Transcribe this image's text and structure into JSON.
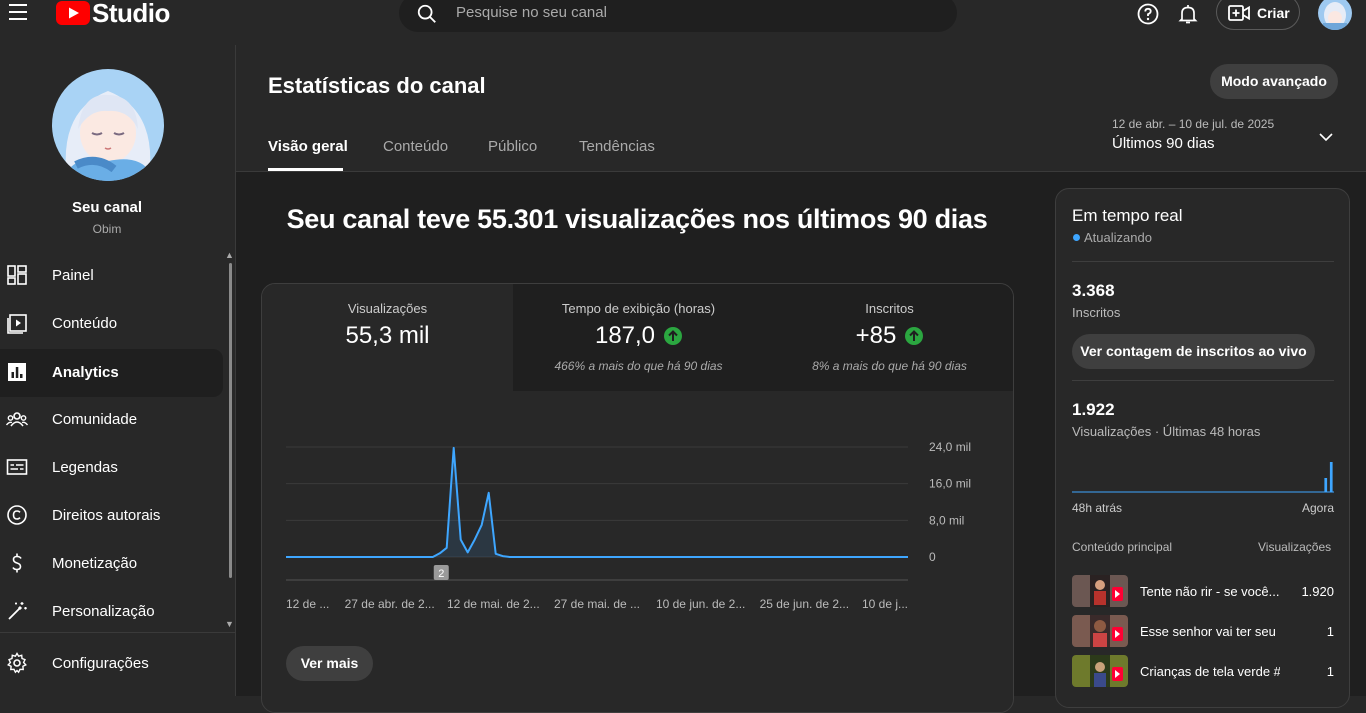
{
  "topbar": {
    "logo_text": "Studio",
    "search_placeholder": "Pesquise no seu canal",
    "create_label": "Criar"
  },
  "sidebar": {
    "channel_title": "Seu canal",
    "channel_name": "Obim",
    "items": [
      {
        "label": "Painel",
        "icon": "dashboard-icon"
      },
      {
        "label": "Conteúdo",
        "icon": "content-icon"
      },
      {
        "label": "Analytics",
        "icon": "analytics-icon",
        "active": true
      },
      {
        "label": "Comunidade",
        "icon": "community-icon"
      },
      {
        "label": "Legendas",
        "icon": "subtitles-icon"
      },
      {
        "label": "Direitos autorais",
        "icon": "copyright-icon"
      },
      {
        "label": "Monetização",
        "icon": "monetization-icon"
      },
      {
        "label": "Personalização",
        "icon": "customization-icon"
      }
    ],
    "settings_label": "Configurações"
  },
  "header": {
    "title": "Estatísticas do canal",
    "advanced_mode": "Modo avançado",
    "tabs": [
      {
        "label": "Visão geral",
        "active": true
      },
      {
        "label": "Conteúdo"
      },
      {
        "label": "Público"
      },
      {
        "label": "Tendências"
      }
    ],
    "date_range": "12 de abr. – 10 de jul. de 2025",
    "date_label": "Últimos 90 dias"
  },
  "main": {
    "headline": "Seu canal teve 55.301 visualizações nos últimos 90 dias",
    "kpis": [
      {
        "label": "Visualizações",
        "value": "55,3 mil",
        "delta": "",
        "selected": true
      },
      {
        "label": "Tempo de exibição (horas)",
        "value": "187,0",
        "delta": "466% a mais do que há 90 dias",
        "up": true
      },
      {
        "label": "Inscritos",
        "value": "+85",
        "delta": "8% a mais do que há 90 dias",
        "up": true
      }
    ],
    "see_more": "Ver mais"
  },
  "chart_data": {
    "type": "area",
    "metric": "Visualizações",
    "y_ticks": [
      "24,0 mil",
      "16,0 mil",
      "8,0 mil",
      "0"
    ],
    "ylim": [
      0,
      24000
    ],
    "x_tick_labels": [
      "12 de ...",
      "27 de abr. de 2...",
      "12 de mai. de 2...",
      "27 de mai. de ...",
      "10 de jun. de 2...",
      "25 de jun. de 2...",
      "10 de j..."
    ],
    "marker_label": "2",
    "marker_day": 22,
    "series": [
      {
        "values": [
          0,
          0,
          0,
          0,
          0,
          0,
          0,
          0,
          0,
          0,
          0,
          0,
          0,
          0,
          0,
          0,
          0,
          0,
          0,
          0,
          0,
          0,
          800,
          2000,
          23800,
          3800,
          1000,
          3800,
          7000,
          14000,
          700,
          200,
          0,
          0,
          0,
          0,
          0,
          0,
          0,
          0,
          0,
          0,
          0,
          0,
          0,
          0,
          0,
          0,
          0,
          0,
          0,
          0,
          0,
          0,
          0,
          0,
          0,
          0,
          0,
          0,
          0,
          0,
          0,
          0,
          0,
          0,
          0,
          0,
          0,
          0,
          0,
          0,
          0,
          0,
          0,
          0,
          0,
          0,
          0,
          0,
          0,
          0,
          0,
          0,
          0,
          0,
          0,
          0,
          0,
          0
        ]
      }
    ],
    "color": "#3ea6ff",
    "grid": true
  },
  "realtime": {
    "title": "Em tempo real",
    "status": "Atualizando",
    "subscribers": "3.368",
    "subscribers_label": "Inscritos",
    "live_count_button": "Ver contagem de inscritos ao vivo",
    "views": "1.922",
    "views_label": "Visualizações · Últimas 48 horas",
    "bars": [
      0,
      0,
      0,
      0,
      0,
      0,
      0,
      0,
      0,
      0,
      0,
      0,
      0,
      0,
      0,
      0,
      0,
      0,
      0,
      0,
      0,
      0,
      0,
      0,
      0,
      0,
      0,
      0,
      0,
      0,
      0,
      0,
      0,
      0,
      0,
      0,
      0,
      0,
      0,
      0,
      0,
      0,
      0,
      0,
      0,
      0,
      14,
      30
    ],
    "ago_label": "48h atrás",
    "now_label": "Agora",
    "top_content_label": "Conteúdo principal",
    "top_views_label": "Visualizações",
    "top_content": [
      {
        "title": "Tente não rir - se você...",
        "views": "1.920"
      },
      {
        "title": "Esse senhor vai ter seu di...",
        "views": "1"
      },
      {
        "title": "Crianças de tela verde #sh...",
        "views": "1"
      }
    ]
  },
  "colors": {
    "accent": "#3ea6ff",
    "up": "#2ba640",
    "brand_red": "#ff0000"
  }
}
